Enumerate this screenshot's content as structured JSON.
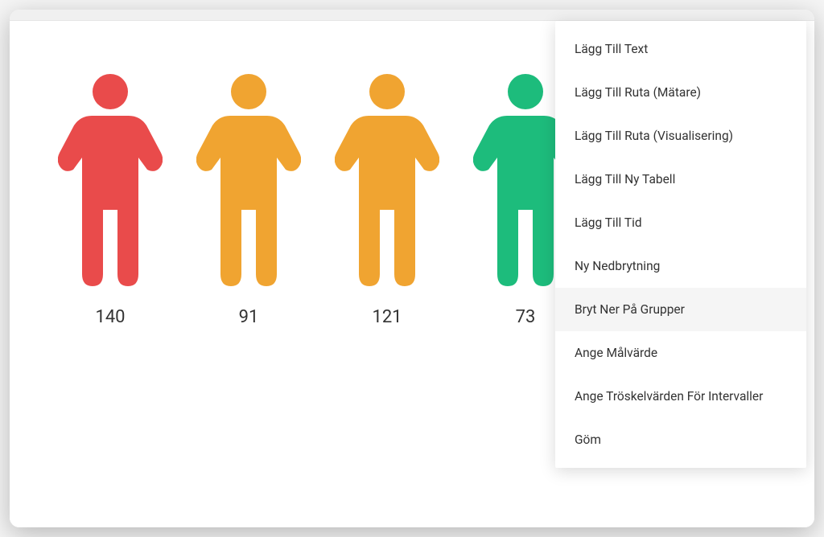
{
  "figures": [
    {
      "value": "140",
      "color": "#e94b4b"
    },
    {
      "value": "91",
      "color": "#f0a431"
    },
    {
      "value": "121",
      "color": "#f0a431"
    },
    {
      "value": "73",
      "color": "#1dbc7c"
    }
  ],
  "menu": {
    "items": [
      {
        "label": "Lägg Till Text",
        "hovered": false
      },
      {
        "label": "Lägg Till Ruta (Mätare)",
        "hovered": false
      },
      {
        "label": "Lägg Till Ruta (Visualisering)",
        "hovered": false
      },
      {
        "label": "Lägg Till Ny Tabell",
        "hovered": false
      },
      {
        "label": "Lägg Till Tid",
        "hovered": false
      },
      {
        "label": "Ny Nedbrytning",
        "hovered": false
      },
      {
        "label": "Bryt Ner På Grupper",
        "hovered": true
      },
      {
        "label": "Ange Målvärde",
        "hovered": false
      },
      {
        "label": "Ange Tröskelvärden För Intervaller",
        "hovered": false
      },
      {
        "label": "Göm",
        "hovered": false
      }
    ]
  }
}
